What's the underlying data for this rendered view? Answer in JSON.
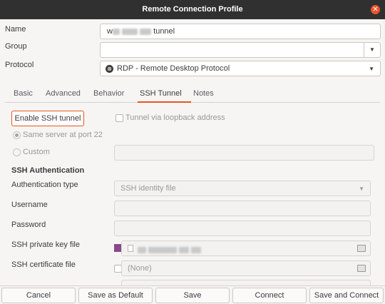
{
  "window": {
    "title": "Remote Connection Profile"
  },
  "form": {
    "name_label": "Name",
    "name_value_prefix": "w",
    "name_value_suffix": "tunnel",
    "group_label": "Group",
    "group_value": "",
    "protocol_label": "Protocol",
    "protocol_value": "RDP - Remote Desktop Protocol"
  },
  "tabs": [
    {
      "label": "Basic"
    },
    {
      "label": "Advanced"
    },
    {
      "label": "Behavior"
    },
    {
      "label": "SSH Tunnel"
    },
    {
      "label": "Notes"
    }
  ],
  "active_tab": "SSH Tunnel",
  "ssh": {
    "enable_button": "Enable SSH tunnel",
    "loopback_label": "Tunnel via loopback address",
    "same_server_label": "Same server at port 22",
    "custom_label": "Custom",
    "auth_title": "SSH Authentication",
    "auth_type_label": "Authentication type",
    "auth_type_value": "SSH identity file",
    "username_label": "Username",
    "password_label": "Password",
    "private_key_label": "SSH private key file",
    "certificate_label": "SSH certificate file",
    "certificate_value": "(None)"
  },
  "footer": {
    "cancel": "Cancel",
    "save_default": "Save as Default",
    "save": "Save",
    "connect": "Connect",
    "save_connect": "Save and Connect"
  },
  "colors": {
    "accent": "#e95420",
    "titlebar": "#303030"
  }
}
